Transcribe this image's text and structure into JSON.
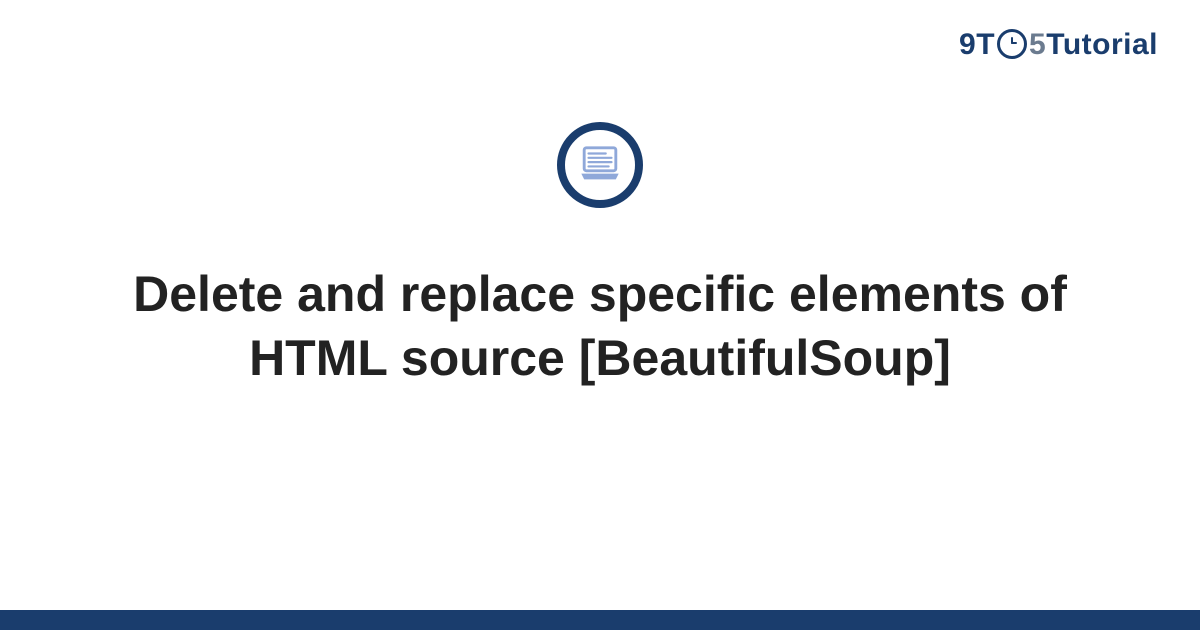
{
  "logo": {
    "part_nine": "9",
    "part_t": "T",
    "part_o_inner": "⎯",
    "part_five": "5",
    "part_tutorial": "Tutorial"
  },
  "title": "Delete and replace specific elements of HTML source [BeautifulSoup]",
  "colors": {
    "brand_primary": "#1a3d6d",
    "brand_muted": "#6b7b8f",
    "icon_fill": "#8fa8d9"
  }
}
